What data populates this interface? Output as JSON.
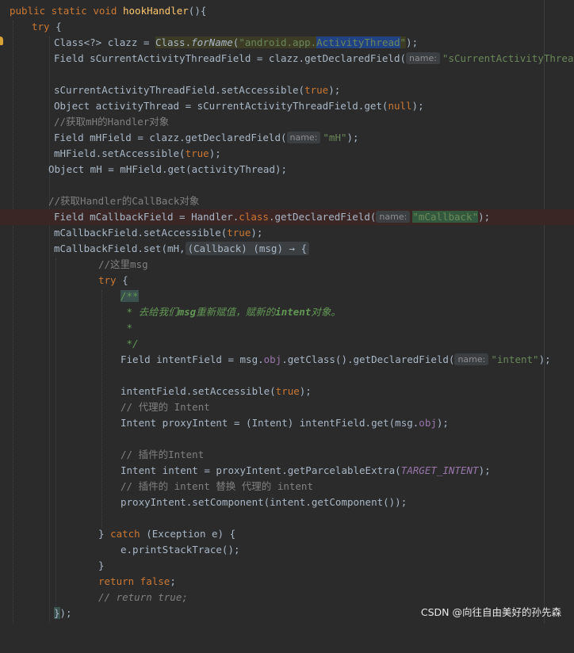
{
  "code": {
    "l1": {
      "kw1": "public static void ",
      "name": "hookHandler",
      "rest": "(){"
    },
    "l2": {
      "kw": "try",
      "rest": " {"
    },
    "l3": {
      "a": "Class<?> clazz = ",
      "cls": "Class.",
      "method": "forName",
      "p": "(",
      "str1": "\"android.app.",
      "sel": "ActivityThread",
      "str2": "\"",
      "end": ");"
    },
    "l4": {
      "a": "Field sCurrentActivityThreadField = clazz.getDeclaredField(",
      "hint": "name:",
      "str": "\"sCurrentActivityThread\"",
      "end": ");"
    },
    "l6": {
      "a": "sCurrentActivityThreadField.setAccessible(",
      "kw": "true",
      "end": ");"
    },
    "l7": {
      "a": "Object activityThread = sCurrentActivityThreadField.get(",
      "kw": "null",
      "end": ");"
    },
    "l8": {
      "cmt": "//获取mH的Handler对象"
    },
    "l9": {
      "a": "Field mHField = clazz.getDeclaredField(",
      "hint": "name:",
      "str": "\"mH\"",
      "end": ");"
    },
    "l10": {
      "a": "mHField.setAccessible(",
      "kw": "true",
      "end": ");"
    },
    "l11": {
      "a": "Object mH = mHField.get(activityThread);"
    },
    "l13": {
      "cmt": "//获取Handler的CallBack对象"
    },
    "l14": {
      "a": "Field mCallbackField = Handler.",
      "kw": "class",
      ".": ".",
      "b": "getDeclaredField(",
      "hint": "name:",
      "str": "\"mCallback\"",
      "end": ");"
    },
    "l15": {
      "a": "mCallbackField.setAccessible(",
      "kw": "true",
      "end": ");"
    },
    "l16": {
      "a": "mCallbackField.set(mH,",
      "fold": "(Callback) (msg) → {"
    },
    "l17": {
      "cmt": "//这里msg"
    },
    "l18": {
      "kw": "try",
      "rest": " {"
    },
    "l19": {
      "doc": "/**"
    },
    "l20": {
      "d1": " * 去给我们",
      "d2": "msg",
      "d3": "重新赋值，赋新的",
      "d4": "intent",
      "d5": "对象。"
    },
    "l21": {
      "doc": " *"
    },
    "l22": {
      "doc": " */"
    },
    "l23": {
      "a": "Field intentField = msg.",
      "fld": "obj",
      "b": ".getClass().getDeclaredField(",
      "hint": "name:",
      "str": "\"intent\"",
      "end": ");"
    },
    "l25": {
      "a": "intentField.setAccessible(",
      "kw": "true",
      "end": ");"
    },
    "l26": {
      "cmt": "// 代理的 Intent"
    },
    "l27": {
      "a": "Intent proxyIntent = (Intent) intentField.get(msg.",
      "fld": "obj",
      "end": ");"
    },
    "l29": {
      "cmt": "// 插件的Intent"
    },
    "l30": {
      "a": "Intent intent = proxyIntent.getParcelableExtra(",
      "const": "TARGET_INTENT",
      "end": ");"
    },
    "l31": {
      "cmt": "// 插件的 intent 替换 代理的 intent"
    },
    "l32": {
      "a": "proxyIntent.setComponent(intent.getComponent());"
    },
    "l34": {
      "a": "} ",
      "kw": "catch",
      "rest": " (Exception e) {"
    },
    "l35": {
      "a": "e.printStackTrace();"
    },
    "l36": {
      "a": "}"
    },
    "l37": {
      "kw": "return false",
      "end": ";"
    },
    "l38": {
      "cmt": "// return true;"
    },
    "l39": {
      "a": "}",
      "b": ");"
    }
  },
  "watermark": "CSDN @向往自由美好的孙先森",
  "colors": {
    "background": "#2b2b2b",
    "keyword": "#cc7832",
    "string": "#6a8759",
    "comment": "#808080",
    "field": "#9876aa",
    "text": "#a9b7c6"
  }
}
